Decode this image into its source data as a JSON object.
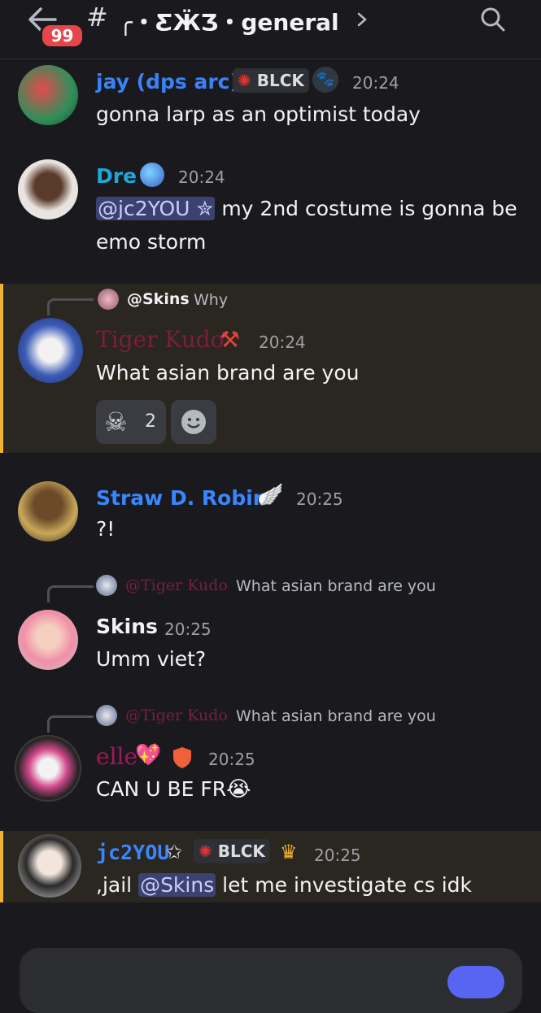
{
  "header": {
    "unread_badge": "99",
    "hash": "#",
    "channel_name": "╭・ƸӜƷ・general",
    "icons": [
      "back-arrow-icon",
      "chevron-right-icon",
      "search-icon"
    ]
  },
  "messages": [
    {
      "username": "jay (dps arc)",
      "name_color": "#3b82f6",
      "tag": "BLCK",
      "time": "20:24",
      "text": "gonna larp as an optimist today"
    },
    {
      "username": "Dre",
      "name_color": "#1ea7d7",
      "time": "20:24",
      "mention": "@jc2YOU ✮",
      "text": " my 2nd costume is gonna be",
      "text2": "emo storm"
    },
    {
      "reply_name": "@Skins",
      "reply_text": "Why",
      "username": "Tiger Kudo",
      "name_color": "#7a1f3d",
      "time": "20:24",
      "text": "What asian brand are you",
      "reaction_count": "2"
    },
    {
      "username": "Straw D. Robin",
      "name_color": "#3a86ff",
      "time": "20:25",
      "text": "?!"
    },
    {
      "reply_name": "@Tiger Kudo",
      "reply_text": "What asian brand are you",
      "username": "Skins",
      "name_color": "#f2f3f5",
      "time": "20:25",
      "text": "Umm viet?"
    },
    {
      "reply_name": "@Tiger Kudo",
      "reply_text": "What asian brand are you",
      "username": "elle",
      "name_color": "#a3165b",
      "time": "20:25",
      "text": "CAN U BE FR"
    },
    {
      "username": "jc2YOU",
      "name_color": "#3a86ff",
      "tag": "BLCK",
      "time": "20:25",
      "text_pre": ",jail ",
      "mention": "@Skins",
      "text": " let me investigate cs idk"
    }
  ],
  "colors": {
    "background": "#1a1a1e",
    "highlight_bg": "#2a2620",
    "highlight_bar": "#f0b232",
    "badge": "#e5464b",
    "mention_bg": "#3c4270",
    "send_button": "#5865f2"
  }
}
